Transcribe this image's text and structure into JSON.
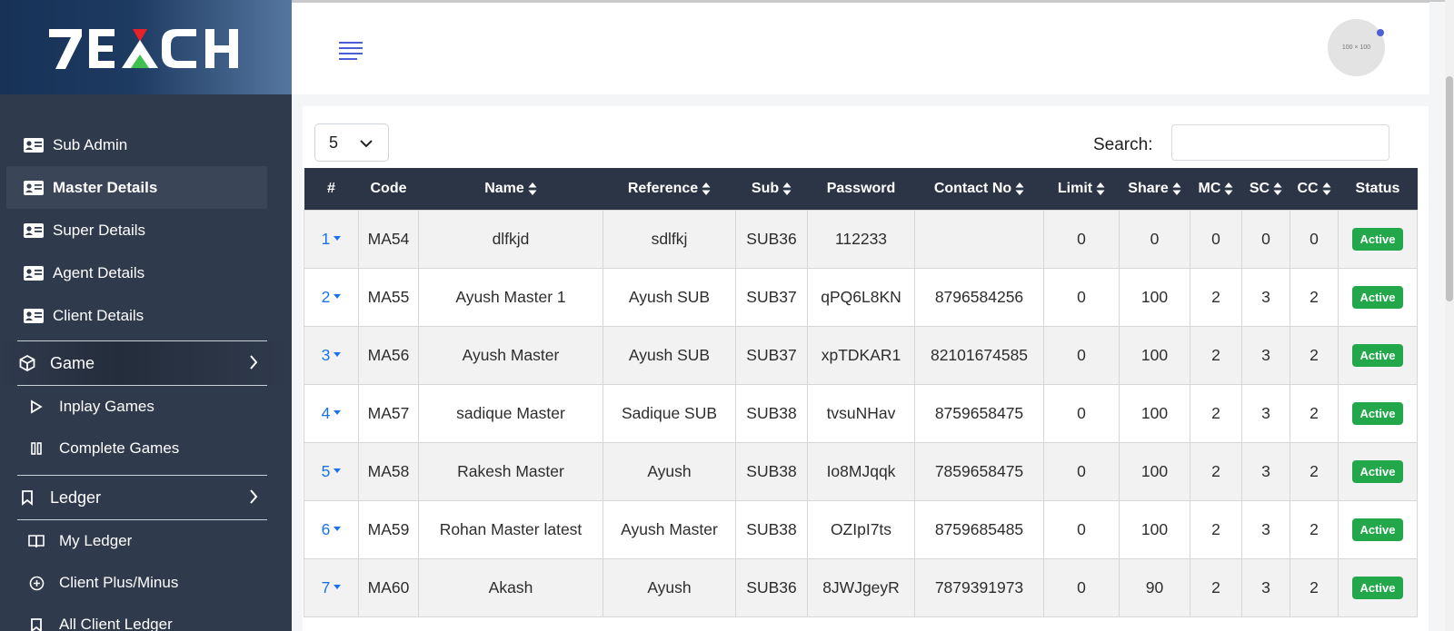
{
  "brand": {
    "logo_text": "7EXCH"
  },
  "sidebar": {
    "items": [
      {
        "label": "Sub Admin",
        "icon": "id-card-icon",
        "active": false
      },
      {
        "label": "Master Details",
        "icon": "id-card-icon",
        "active": true
      },
      {
        "label": "Super Details",
        "icon": "id-card-icon",
        "active": false
      },
      {
        "label": "Agent Details",
        "icon": "id-card-icon",
        "active": false
      },
      {
        "label": "Client Details",
        "icon": "id-card-icon",
        "active": false
      }
    ],
    "game_group": {
      "label": "Game",
      "icon": "cube-icon",
      "items": [
        {
          "label": "Inplay Games",
          "icon": "play-icon"
        },
        {
          "label": "Complete Games",
          "icon": "pause-icon"
        }
      ]
    },
    "ledger_group": {
      "label": "Ledger",
      "icon": "bookmark-icon",
      "items": [
        {
          "label": "My Ledger",
          "icon": "book-icon"
        },
        {
          "label": "Client Plus/Minus",
          "icon": "plus-circle-icon"
        },
        {
          "label": "All Client Ledger",
          "icon": "bookmark-icon"
        }
      ]
    }
  },
  "header": {
    "avatar_text": "100 × 100"
  },
  "controls": {
    "page_length": "5",
    "search_label": "Search:",
    "search_value": ""
  },
  "table": {
    "columns": [
      "#",
      "Code",
      "Name",
      "Reference",
      "Sub",
      "Password",
      "Contact No",
      "Limit",
      "Share",
      "MC",
      "SC",
      "CC",
      "Status"
    ],
    "rows": [
      {
        "idx": "1",
        "code": "MA54",
        "name": "dlfkjd",
        "reference": "sdlfkj",
        "sub": "SUB36",
        "password": "112233",
        "contact": "",
        "limit": "0",
        "share": "0",
        "mc": "0",
        "sc": "0",
        "cc": "0",
        "status": "Active"
      },
      {
        "idx": "2",
        "code": "MA55",
        "name": "Ayush Master 1",
        "reference": "Ayush SUB",
        "sub": "SUB37",
        "password": "qPQ6L8KN",
        "contact": "8796584256",
        "limit": "0",
        "share": "100",
        "mc": "2",
        "sc": "3",
        "cc": "2",
        "status": "Active"
      },
      {
        "idx": "3",
        "code": "MA56",
        "name": "Ayush Master",
        "reference": "Ayush SUB",
        "sub": "SUB37",
        "password": "xpTDKAR1",
        "contact": "82101674585",
        "limit": "0",
        "share": "100",
        "mc": "2",
        "sc": "3",
        "cc": "2",
        "status": "Active"
      },
      {
        "idx": "4",
        "code": "MA57",
        "name": "sadique Master",
        "reference": "Sadique SUB",
        "sub": "SUB38",
        "password": "tvsuNHav",
        "contact": "8759658475",
        "limit": "0",
        "share": "100",
        "mc": "2",
        "sc": "3",
        "cc": "2",
        "status": "Active"
      },
      {
        "idx": "5",
        "code": "MA58",
        "name": "Rakesh Master",
        "reference": "Ayush",
        "sub": "SUB38",
        "password": "Io8MJqqk",
        "contact": "7859658475",
        "limit": "0",
        "share": "100",
        "mc": "2",
        "sc": "3",
        "cc": "2",
        "status": "Active"
      },
      {
        "idx": "6",
        "code": "MA59",
        "name": "Rohan Master latest",
        "reference": "Ayush Master",
        "sub": "SUB38",
        "password": "OZIpI7ts",
        "contact": "8759685485",
        "limit": "0",
        "share": "100",
        "mc": "2",
        "sc": "3",
        "cc": "2",
        "status": "Active"
      },
      {
        "idx": "7",
        "code": "MA60",
        "name": "Akash",
        "reference": "Ayush",
        "sub": "SUB36",
        "password": "8JWJgeyR",
        "contact": "7879391973",
        "limit": "0",
        "share": "90",
        "mc": "2",
        "sc": "3",
        "cc": "2",
        "status": "Active"
      }
    ]
  },
  "colors": {
    "sidebar_bg": "#2f3a4c",
    "table_header_bg": "#2c3545",
    "active_badge": "#22a74a",
    "link": "#1a73e8",
    "accent": "#4b5fd6"
  }
}
